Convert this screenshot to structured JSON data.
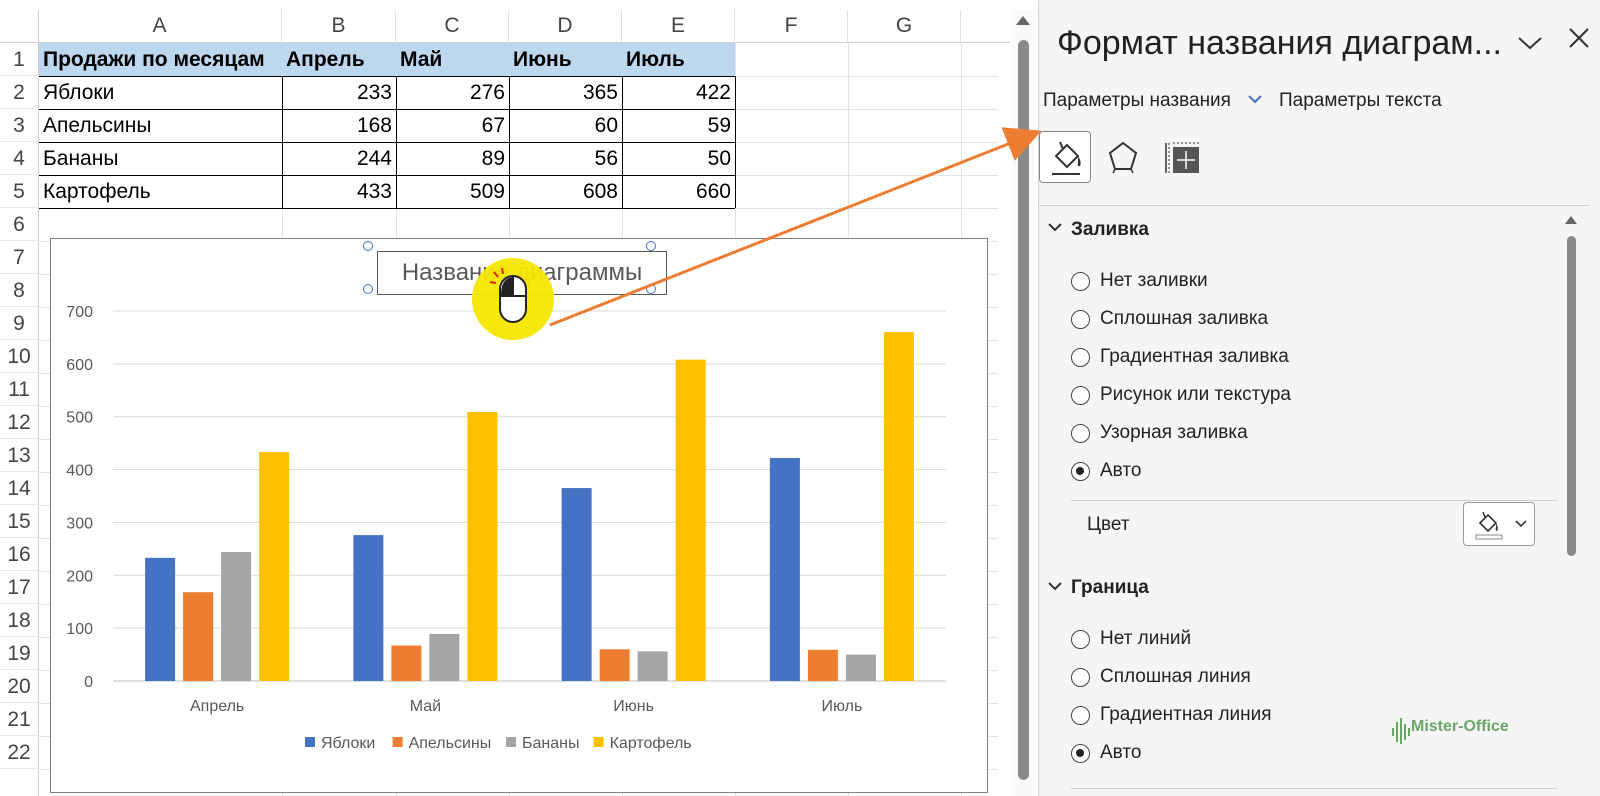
{
  "sheet": {
    "columns": [
      "A",
      "B",
      "C",
      "D",
      "E",
      "F",
      "G"
    ],
    "rows": [
      "1",
      "2",
      "3",
      "4",
      "5",
      "6",
      "7",
      "8",
      "9",
      "10",
      "11",
      "12",
      "13",
      "14",
      "15",
      "16",
      "17",
      "18",
      "19",
      "20",
      "21",
      "22"
    ],
    "table": {
      "header": [
        "Продажи по месяцам",
        "Апрель",
        "Май",
        "Июнь",
        "Июль"
      ],
      "body": [
        [
          "Яблоки",
          "233",
          "276",
          "365",
          "422"
        ],
        [
          "Апельсины",
          "168",
          "67",
          "60",
          "59"
        ],
        [
          "Бананы",
          "244",
          "89",
          "56",
          "50"
        ],
        [
          "Картофель",
          "433",
          "509",
          "608",
          "660"
        ]
      ]
    }
  },
  "chart": {
    "title": "Название диаграммы"
  },
  "chart_data": {
    "type": "bar",
    "title": "Название диаграммы",
    "categories": [
      "Апрель",
      "Май",
      "Июнь",
      "Июль"
    ],
    "series": [
      {
        "name": "Яблоки",
        "values": [
          233,
          276,
          365,
          422
        ],
        "color": "#4472c4"
      },
      {
        "name": "Апельсины",
        "values": [
          168,
          67,
          60,
          59
        ],
        "color": "#ed7d31"
      },
      {
        "name": "Бананы",
        "values": [
          244,
          89,
          56,
          50
        ],
        "color": "#a5a5a5"
      },
      {
        "name": "Картофель",
        "values": [
          433,
          509,
          608,
          660
        ],
        "color": "#ffc000"
      }
    ],
    "yticks": [
      "0",
      "100",
      "200",
      "300",
      "400",
      "500",
      "600",
      "700"
    ],
    "ylim": [
      0,
      700
    ],
    "grid": true,
    "legend": "bottom"
  },
  "pane": {
    "title": "Формат названия диаграм...",
    "tabs": {
      "title_options": "Параметры названия",
      "text_options": "Параметры текста"
    },
    "icons": [
      "fill-line-icon",
      "effects-icon",
      "size-properties-icon"
    ],
    "fill": {
      "heading": "Заливка",
      "options": [
        "Нет заливки",
        "Сплошная заливка",
        "Градиентная заливка",
        "Рисунок или текстура",
        "Узорная заливка",
        "Авто"
      ],
      "selected": "Авто",
      "color_label": "Цвет"
    },
    "border": {
      "heading": "Граница",
      "options": [
        "Нет линий",
        "Сплошная линия",
        "Градиентная линия",
        "Авто"
      ],
      "selected": "Авто"
    }
  },
  "watermark": "Mister-Office",
  "colors": {
    "header_fill": "#bdd7ee",
    "accent": "#4472c4",
    "arrow": "#ed7d31",
    "cursor_highlight": "#f5e600"
  }
}
